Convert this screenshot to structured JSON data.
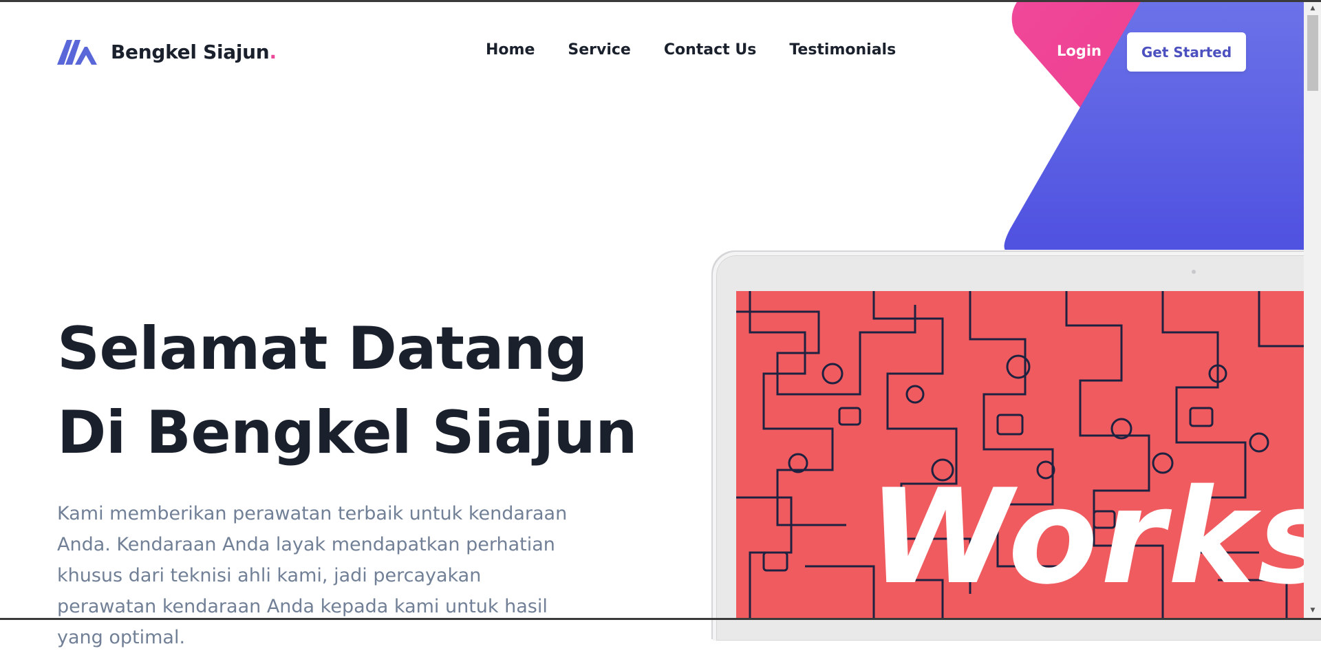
{
  "brand": {
    "name": "Bengkel Siajun",
    "dot": ".",
    "accent": "#ec4899",
    "logo_color": "#5a67d8"
  },
  "nav": {
    "items": [
      {
        "label": "Home"
      },
      {
        "label": "Service"
      },
      {
        "label": "Contact Us"
      },
      {
        "label": "Testimonials"
      }
    ],
    "login_label": "Login",
    "cta_label": "Get Started"
  },
  "hero": {
    "title_line1": "Selamat Datang",
    "title_line2": "Di Bengkel Siajun",
    "subtitle": "Kami memberikan perawatan terbaik untuk kendaraan Anda. Kendaraan Anda layak mendapatkan perhatian khusus dari teknisi ahli kami, jadi percayakan perawatan kendaraan Anda kepada kami untuk hasil yang optimal."
  },
  "showcase": {
    "screen_text": "Works",
    "screen_color": "#ef5b5f"
  },
  "colors": {
    "pink": "#ec4899",
    "indigo": "#5a67d8",
    "dark": "#1a202c",
    "muted": "#718096"
  }
}
